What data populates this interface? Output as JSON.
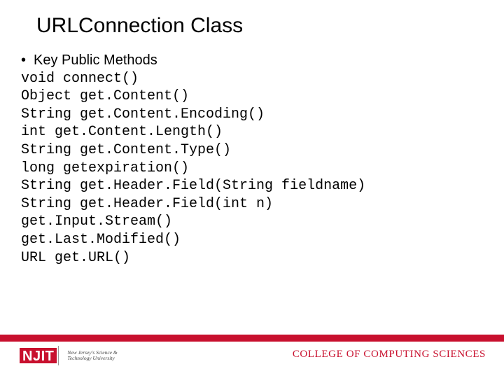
{
  "title": "URLConnection Class",
  "bullet": "•",
  "bullet_label": "Key Public Methods",
  "methods": {
    "m0": "void connect()",
    "m1": "Object get.Content()",
    "m2": "String get.Content.Encoding()",
    "m3": "int get.Content.Length()",
    "m4": "String get.Content.Type()",
    "m5": "long getexpiration()",
    "m6": "String get.Header.Field(String fieldname)",
    "m7": "String get.Header.Field(int n)",
    "m8": "get.Input.Stream()",
    "m9": "get.Last.Modified()",
    "m10": "URL get.URL()"
  },
  "footer": {
    "njit": "NJIT",
    "sub1": "New Jersey's Science &",
    "sub2": "Technology University",
    "college": "COLLEGE OF COMPUTING SCIENCES"
  }
}
